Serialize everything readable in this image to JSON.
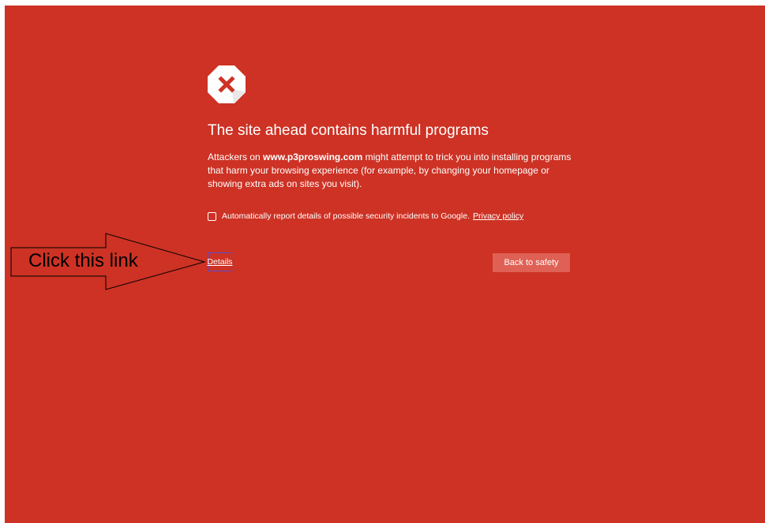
{
  "interstitial": {
    "title": "The site ahead contains harmful programs",
    "body_prefix": "Attackers on ",
    "site": "www.p3proswing.com",
    "body_suffix": " might attempt to trick you into installing programs that harm your browsing experience (for example, by changing your homepage or showing extra ads on sites you visit).",
    "report_label": "Automatically report details of possible security incidents to Google.",
    "privacy_link": "Privacy policy",
    "report_checked": false,
    "details_label": "Details",
    "back_button": "Back to safety"
  },
  "annotation": {
    "text": "Click this link"
  },
  "colors": {
    "background": "#cd3224",
    "button": "#df6155",
    "text": "#ffffff"
  },
  "icons": {
    "warning": "stop-octagon-x-icon"
  }
}
